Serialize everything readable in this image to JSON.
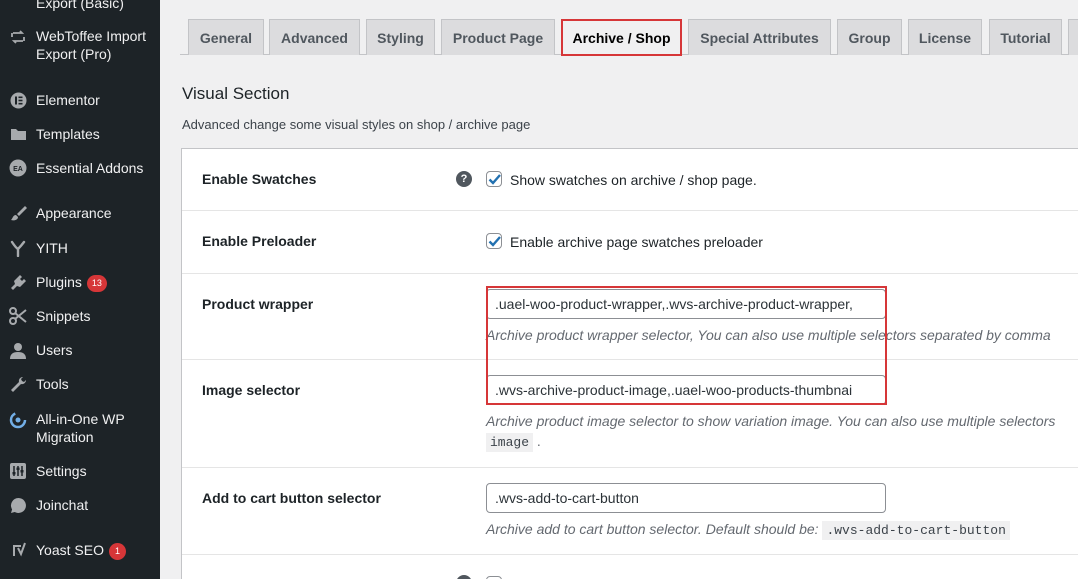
{
  "sidebar": {
    "items": [
      {
        "label": "Export (Basic)",
        "icon": "export-icon"
      },
      {
        "label": "WebToffee Import Export (Pro)",
        "icon": "import-export-icon"
      },
      {
        "label": "Elementor",
        "icon": "elementor-icon"
      },
      {
        "label": "Templates",
        "icon": "folder-icon"
      },
      {
        "label": "Essential Addons",
        "icon": "ea-icon"
      },
      {
        "label": "Appearance",
        "icon": "paintbrush-icon"
      },
      {
        "label": "YITH",
        "icon": "yith-icon"
      },
      {
        "label": "Plugins",
        "icon": "plugin-icon",
        "badge": "13"
      },
      {
        "label": "Snippets",
        "icon": "scissors-icon"
      },
      {
        "label": "Users",
        "icon": "user-icon"
      },
      {
        "label": "Tools",
        "icon": "wrench-icon"
      },
      {
        "label": "All-in-One WP Migration",
        "icon": "migration-icon"
      },
      {
        "label": "Settings",
        "icon": "settings-icon"
      },
      {
        "label": "Joinchat",
        "icon": "whatsapp-icon"
      },
      {
        "label": "Yoast SEO",
        "icon": "yoast-icon",
        "badge": "1"
      }
    ]
  },
  "tabs": [
    {
      "label": "General"
    },
    {
      "label": "Advanced"
    },
    {
      "label": "Styling"
    },
    {
      "label": "Product Page"
    },
    {
      "label": "Archive / Shop",
      "active": true
    },
    {
      "label": "Special Attributes"
    },
    {
      "label": "Group"
    },
    {
      "label": "License"
    },
    {
      "label": "Tutorial"
    }
  ],
  "section": {
    "title": "Visual Section",
    "description": "Advanced change some visual styles on shop / archive page"
  },
  "rows": {
    "enable_swatches": {
      "label": "Enable Swatches",
      "help": "?",
      "checked": true,
      "checkbox_label": "Show swatches on archive / shop page."
    },
    "enable_preloader": {
      "label": "Enable Preloader",
      "checked": true,
      "checkbox_label": "Enable archive page swatches preloader"
    },
    "product_wrapper": {
      "label": "Product wrapper",
      "value": ".uael-woo-product-wrapper,.wvs-archive-product-wrapper,",
      "description": "Archive product wrapper selector, You can also use multiple selectors separated by comma"
    },
    "image_selector": {
      "label": "Image selector",
      "value": ".wvs-archive-product-image,.uael-woo-products-thumbnai",
      "description": "Archive product image selector to show variation image. You can also use multiple selectors",
      "code": "image",
      "code_suffix": "."
    },
    "add_to_cart": {
      "label": "Add to cart button selector",
      "value": ".wvs-add-to-cart-button",
      "description": "Archive add to cart button selector. Default should be:",
      "code": ".wvs-add-to-cart-button"
    }
  },
  "colors": {
    "sidebar_bg": "#1d2327",
    "accent_red": "#d63638",
    "checkbox_blue": "#2271b1"
  }
}
